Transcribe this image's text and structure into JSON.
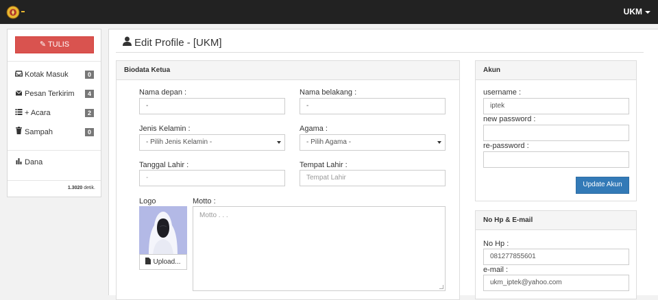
{
  "navbar": {
    "logo_suffix": "-",
    "user_label": "UKM"
  },
  "sidebar": {
    "write_button": "TULIS",
    "items": [
      {
        "label": "Kotak Masuk",
        "icon": "inbox-icon",
        "count": "0"
      },
      {
        "label": "Pesan Terkirim",
        "icon": "envelope-icon",
        "count": "4"
      },
      {
        "label": "+ Acara",
        "icon": "list-icon",
        "count": "2"
      },
      {
        "label": "Sampah",
        "icon": "trash-icon",
        "count": "0"
      }
    ],
    "dana_label": "Dana",
    "timing_value": "1.3020",
    "timing_unit": "detik."
  },
  "main": {
    "title": "Edit Profile - [UKM]"
  },
  "biodata": {
    "heading": "Biodata Ketua",
    "first_name_label": "Nama depan :",
    "first_name_value": "-",
    "last_name_label": "Nama belakang :",
    "last_name_value": "-",
    "gender_label": "Jenis Kelamin :",
    "gender_value": "- Pilih Jenis Kelamin -",
    "religion_label": "Agama :",
    "religion_value": "- Pilih Agama -",
    "dob_label": "Tanggal Lahir :",
    "dob_value": "-",
    "pob_label": "Tempat Lahir :",
    "pob_placeholder": "Tempat Lahir",
    "logo_label": "Logo",
    "upload_label": "Upload...",
    "motto_label": "Motto :",
    "motto_placeholder": "Motto . . ."
  },
  "account": {
    "heading": "Akun",
    "username_label": "username :",
    "username_value": "iptek",
    "new_password_label": "new password :",
    "repassword_label": "re-password :",
    "update_button": "Update Akun"
  },
  "contact": {
    "heading": "No Hp & E-mail",
    "phone_label": "No Hp :",
    "phone_value": "081277855601",
    "email_label": "e-mail :",
    "email_value": "ukm_iptek@yahoo.com"
  },
  "colors": {
    "navbar": "#222222",
    "danger": "#d9534f",
    "primary": "#337ab7",
    "badge": "#777777"
  }
}
